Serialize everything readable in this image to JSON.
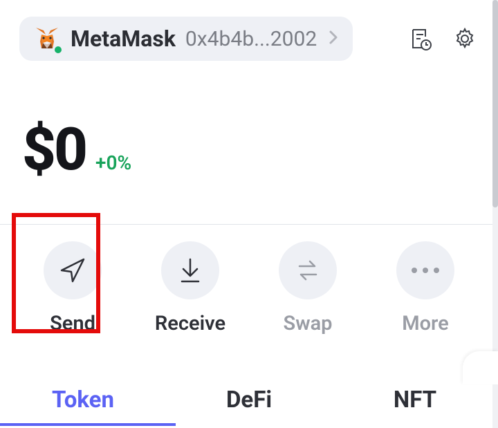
{
  "header": {
    "account_name": "MetaMask",
    "account_address_short": "0x4b4b...2002"
  },
  "balance": {
    "value": "$0",
    "change": "+0%"
  },
  "actions": {
    "send": "Send",
    "receive": "Receive",
    "swap": "Swap",
    "more": "More"
  },
  "tabs": {
    "token": "Token",
    "defi": "DeFi",
    "nft": "NFT"
  },
  "highlighted_action": "send"
}
